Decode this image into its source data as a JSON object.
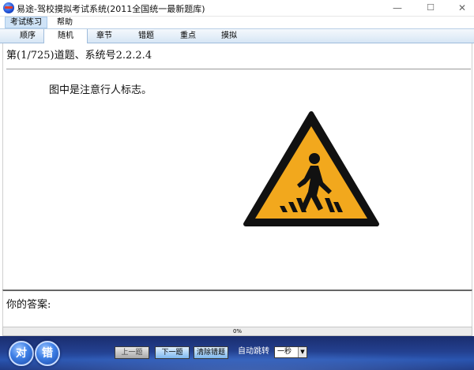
{
  "window": {
    "title": "易途-驾校摸拟考试系统(2011全国统一最新题库)",
    "minimize": "—",
    "maximize": "☐",
    "close": "✕"
  },
  "menu": {
    "items": [
      {
        "label": "考试练习"
      },
      {
        "label": "帮助"
      }
    ]
  },
  "tabs": [
    {
      "label": "顺序"
    },
    {
      "label": "随机"
    },
    {
      "label": "章节"
    },
    {
      "label": "错题"
    },
    {
      "label": "重点"
    },
    {
      "label": "摸拟"
    }
  ],
  "question": {
    "header": "第(1/725)道题、系统号2.2.2.4",
    "text": "图中是注意行人标志。"
  },
  "answer": {
    "label": "你的答案:"
  },
  "progress": {
    "value": 0,
    "text": "0%"
  },
  "toolbar": {
    "correct_label": "对",
    "wrong_label": "错",
    "prev_label": "上一题",
    "next_label": "下一题",
    "clear_label": "清除错题",
    "auto_jump_label": "自动跳转",
    "auto_jump_value": "一秒",
    "select_arrow": "▼"
  },
  "colors": {
    "sign_fill": "#f2a81d",
    "sign_border": "#111111",
    "toolbar_bg": "#23408f",
    "progress_fill": "#3c7be0"
  }
}
